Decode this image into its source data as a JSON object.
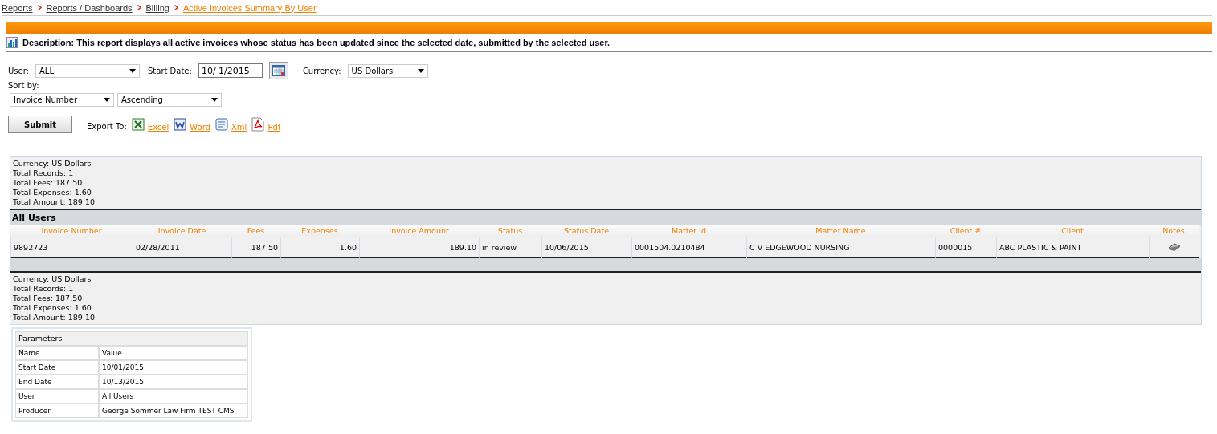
{
  "breadcrumb": [
    {
      "label": "Reports",
      "current": false
    },
    {
      "label": "Reports / Dashboards",
      "current": false
    },
    {
      "label": "Billing",
      "current": false
    },
    {
      "label": "Active Invoices Summary By User",
      "current": true
    }
  ],
  "description": "Description: This report displays all active invoices whose status has been updated since the selected date, submitted by the selected user.",
  "filters": {
    "user": {
      "label": "User:",
      "value": "ALL"
    },
    "start_date": {
      "label": "Start Date:",
      "value": "10/ 1/2015"
    },
    "currency": {
      "label": "Currency:",
      "value": "US Dollars"
    }
  },
  "sort": {
    "label": "Sort by:",
    "field": "Invoice Number",
    "order": "Ascending"
  },
  "submit": "Submit",
  "export": {
    "label": "Export To:",
    "links": [
      {
        "kind": "excel",
        "label": "Excel"
      },
      {
        "kind": "word",
        "label": "Word"
      },
      {
        "kind": "xml",
        "label": "Xml"
      },
      {
        "kind": "pdf",
        "label": "Pdf"
      }
    ]
  },
  "summary_top": [
    "Currency: US Dollars",
    "Total Records: 1",
    "Total Fees: 187.50",
    "Total Expenses: 1.60",
    "Total Amount: 189.10"
  ],
  "group_title": "All Users",
  "table": {
    "columns": [
      {
        "label": "Invoice Number",
        "kind": "text"
      },
      {
        "label": "Invoice Date",
        "kind": "text"
      },
      {
        "label": "Fees",
        "kind": "number"
      },
      {
        "label": "Expenses",
        "kind": "number"
      },
      {
        "label": "Invoice Amount",
        "kind": "number"
      },
      {
        "label": "Status",
        "kind": "text"
      },
      {
        "label": "Status Date",
        "kind": "text"
      },
      {
        "label": "Matter Id",
        "kind": "text"
      },
      {
        "label": "Matter Name",
        "kind": "text"
      },
      {
        "label": "Client #",
        "kind": "text"
      },
      {
        "label": "Client",
        "kind": "text"
      },
      {
        "label": "Notes",
        "kind": "icon"
      }
    ],
    "rows": [
      {
        "cells": [
          "9892723",
          "02/28/2011",
          "187.50",
          "1.60",
          "189.10",
          "in review",
          "10/06/2015",
          "0001504.0210484",
          "C V EDGEWOOD NURSING",
          "0000015",
          "ABC PLASTIC & PAINT"
        ]
      }
    ]
  },
  "summary_bottom": [
    "Currency: US Dollars",
    "Total Records: 1",
    "Total Fees: 187.50",
    "Total Expenses: 1.60",
    "Total Amount: 189.10"
  ],
  "parameters": {
    "title": "Parameters",
    "header": [
      "Name",
      "Value"
    ],
    "rows": [
      [
        "Start Date",
        "10/01/2015"
      ],
      [
        "End Date",
        "10/13/2015"
      ],
      [
        "User",
        "All Users"
      ],
      [
        "Producer",
        "George Sommer Law Firm TEST CMS"
      ]
    ]
  }
}
